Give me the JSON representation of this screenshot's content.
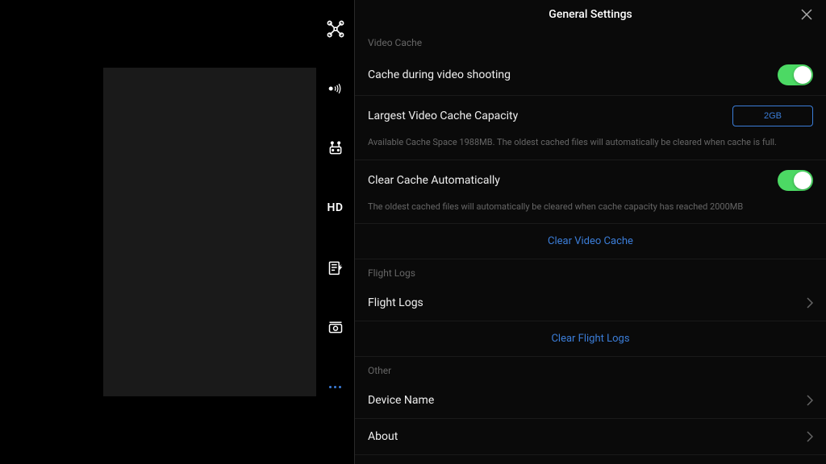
{
  "panel": {
    "title": "General Settings"
  },
  "sections": {
    "videoCache": {
      "label": "Video Cache",
      "cacheShootingLabel": "Cache during video shooting",
      "largestCapacityLabel": "Largest Video Cache Capacity",
      "capacityValue": "2GB",
      "availableSpaceText": "Available Cache Space 1988MB. The oldest cached files will automatically be cleared when cache is full.",
      "clearAutoLabel": "Clear Cache Automatically",
      "clearAutoHelpText": "The oldest cached files will automatically be cleared when cache capacity has reached 2000MB",
      "clearVideoCacheLink": "Clear Video Cache"
    },
    "flightLogs": {
      "label": "Flight Logs",
      "flightLogsLabel": "Flight Logs",
      "clearFlightLogsLink": "Clear Flight Logs"
    },
    "other": {
      "label": "Other",
      "deviceNameLabel": "Device Name",
      "aboutLabel": "About"
    }
  },
  "sidebar": {
    "hdLabel": "HD"
  }
}
